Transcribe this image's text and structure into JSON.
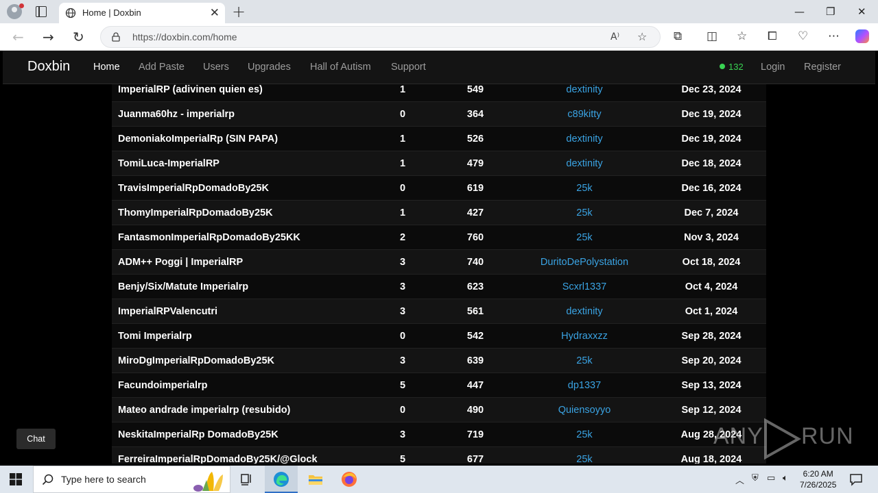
{
  "browser": {
    "tab_title": "Home | Doxbin",
    "url": "https://doxbin.com/home"
  },
  "site": {
    "brand": "Doxbin",
    "nav": [
      "Home",
      "Add Paste",
      "Users",
      "Upgrades",
      "Hall of Autism",
      "Support"
    ],
    "online_count": "132",
    "login": "Login",
    "register": "Register",
    "chat_label": "Chat",
    "accent_color": "#3aa3e3",
    "online_color": "#39d353"
  },
  "pastes": [
    {
      "title": "ImperialRP (adivinen quien es)",
      "comments": "1",
      "views": "549",
      "user": "dextinity",
      "date": "Dec 23, 2024"
    },
    {
      "title": "Juanma60hz - imperialrp",
      "comments": "0",
      "views": "364",
      "user": "c89kitty",
      "date": "Dec 19, 2024"
    },
    {
      "title": "DemoniakoImperialRp (SIN PAPA)",
      "comments": "1",
      "views": "526",
      "user": "dextinity",
      "date": "Dec 19, 2024"
    },
    {
      "title": "TomiLuca-ImperialRP",
      "comments": "1",
      "views": "479",
      "user": "dextinity",
      "date": "Dec 18, 2024"
    },
    {
      "title": "TravisImperialRpDomadoBy25K",
      "comments": "0",
      "views": "619",
      "user": "25k",
      "date": "Dec 16, 2024"
    },
    {
      "title": "ThomyImperialRpDomadoBy25K",
      "comments": "1",
      "views": "427",
      "user": "25k",
      "date": "Dec 7, 2024"
    },
    {
      "title": "FantasmonImperialRpDomadoBy25KK",
      "comments": "2",
      "views": "760",
      "user": "25k",
      "date": "Nov 3, 2024"
    },
    {
      "title": "ADM++ Poggi | ImperialRP",
      "comments": "3",
      "views": "740",
      "user": "DuritoDePolystation",
      "date": "Oct 18, 2024"
    },
    {
      "title": "Benjy/Six/Matute Imperialrp",
      "comments": "3",
      "views": "623",
      "user": "Scxrl1337",
      "date": "Oct 4, 2024"
    },
    {
      "title": "ImperialRPValencutri",
      "comments": "3",
      "views": "561",
      "user": "dextinity",
      "date": "Oct 1, 2024"
    },
    {
      "title": "Tomi Imperialrp",
      "comments": "0",
      "views": "542",
      "user": "Hydraxxzz",
      "date": "Sep 28, 2024"
    },
    {
      "title": "MiroDgImperialRpDomadoBy25K",
      "comments": "3",
      "views": "639",
      "user": "25k",
      "date": "Sep 20, 2024"
    },
    {
      "title": "Facundoimperialrp",
      "comments": "5",
      "views": "447",
      "user": "dp1337",
      "date": "Sep 13, 2024"
    },
    {
      "title": "Mateo andrade imperialrp (resubido)",
      "comments": "0",
      "views": "490",
      "user": "Quiensoyyo",
      "date": "Sep 12, 2024"
    },
    {
      "title": "NeskitaImperialRp DomadoBy25K",
      "comments": "3",
      "views": "719",
      "user": "25k",
      "date": "Aug 28, 2024"
    },
    {
      "title": "FerreiraImperialRpDomadoBy25K/@Glock",
      "comments": "5",
      "views": "677",
      "user": "25k",
      "date": "Aug 18, 2024"
    }
  ],
  "watermark": "ANY RUN",
  "taskbar": {
    "search_placeholder": "Type here to search",
    "time": "6:20 AM",
    "date": "7/26/2025"
  }
}
